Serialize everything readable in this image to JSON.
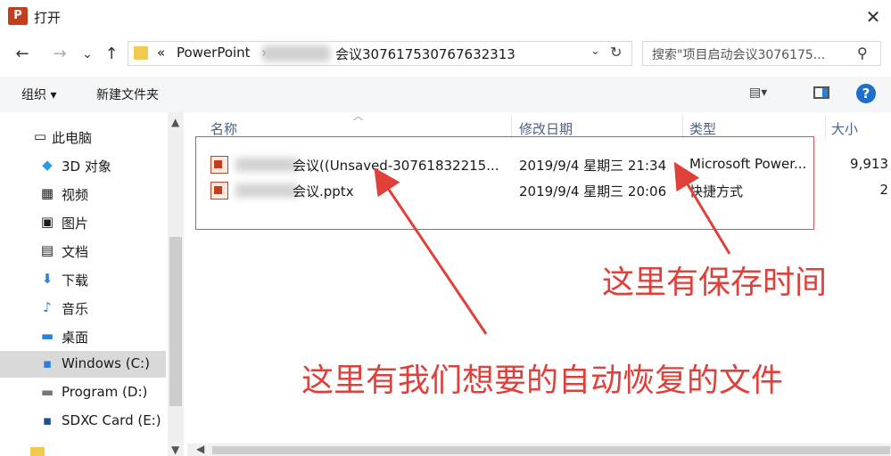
{
  "window": {
    "title": "打开",
    "app_badge": "P"
  },
  "nav": {
    "back": "←",
    "forward": "→",
    "recent": "⌄",
    "up": "↑"
  },
  "address": {
    "prefix": "«",
    "path_start": "PowerPoint",
    "sep": "›",
    "path_end": "会议307617530767632313",
    "dropdown": "⌄",
    "refresh": "↻"
  },
  "search": {
    "placeholder": "搜索\"项目启动会议3076175...",
    "icon": "search-icon"
  },
  "toolbar": {
    "organize": "组织 ▾",
    "new_folder": "新建文件夹",
    "view": "▤▾",
    "help": "?"
  },
  "sidebar": {
    "items": [
      {
        "label": "此电脑",
        "icon": "computer-icon",
        "glyph": "▭"
      },
      {
        "label": "3D 对象",
        "icon": "cube-icon",
        "glyph": "◆"
      },
      {
        "label": "视频",
        "icon": "film-icon",
        "glyph": "▦"
      },
      {
        "label": "图片",
        "icon": "picture-icon",
        "glyph": "▣"
      },
      {
        "label": "文档",
        "icon": "document-icon",
        "glyph": "▤"
      },
      {
        "label": "下载",
        "icon": "download-icon",
        "glyph": "⬇"
      },
      {
        "label": "音乐",
        "icon": "music-icon",
        "glyph": "♪"
      },
      {
        "label": "桌面",
        "icon": "desktop-icon",
        "glyph": "▬"
      },
      {
        "label": "Windows (C:)",
        "icon": "drive-icon",
        "glyph": "▪",
        "selected": true
      },
      {
        "label": "Program (D:)",
        "icon": "drive-icon",
        "glyph": "▬"
      },
      {
        "label": "SDXC Card (E:)",
        "icon": "sdcard-icon",
        "glyph": "▪"
      }
    ]
  },
  "columns": {
    "name": "名称",
    "modified": "修改日期",
    "type": "类型",
    "size": "大小"
  },
  "files": [
    {
      "name": "会议((Unsaved-30761832215...",
      "modified": "2019/9/4 星期三 21:34",
      "type": "Microsoft Power...",
      "size": "9,913"
    },
    {
      "name": "会议.pptx",
      "modified": "2019/9/4 星期三 20:06",
      "type": "快捷方式",
      "size": "2"
    }
  ],
  "annotations": {
    "save_time": "这里有保存时间",
    "recovered_file": "这里有我们想要的自动恢复的文件"
  },
  "colors": {
    "annotation": "#e0403a",
    "accent": "#1e6fc9"
  }
}
